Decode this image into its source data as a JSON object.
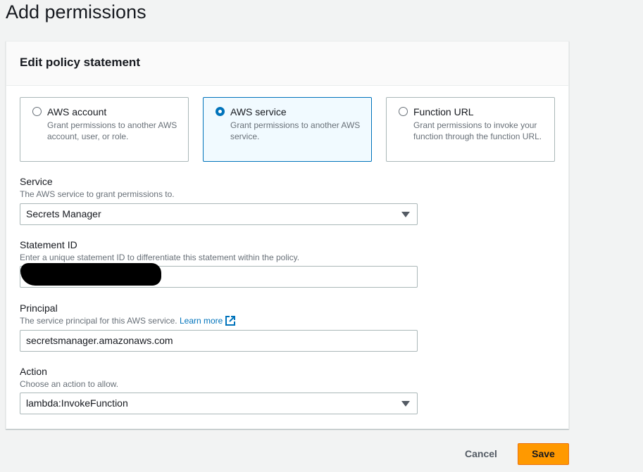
{
  "page": {
    "title": "Add permissions"
  },
  "card": {
    "title": "Edit policy statement"
  },
  "tiles": [
    {
      "title": "AWS account",
      "description": "Grant permissions to another AWS account, user, or role.",
      "selected": false
    },
    {
      "title": "AWS service",
      "description": "Grant permissions to another AWS service.",
      "selected": true
    },
    {
      "title": "Function URL",
      "description": "Grant permissions to invoke your function through the function URL.",
      "selected": false
    }
  ],
  "service": {
    "label": "Service",
    "description": "The AWS service to grant permissions to.",
    "value": "Secrets Manager"
  },
  "statement_id": {
    "label": "Statement ID",
    "description": "Enter a unique statement ID to differentiate this statement within the policy.",
    "value": ""
  },
  "principal": {
    "label": "Principal",
    "description": "The service principal for this AWS service.",
    "learn_more": "Learn more",
    "value": "secretsmanager.amazonaws.com"
  },
  "action": {
    "label": "Action",
    "description": "Choose an action to allow.",
    "value": "lambda:InvokeFunction"
  },
  "footer": {
    "cancel": "Cancel",
    "save": "Save"
  },
  "colors": {
    "accent": "#0073bb",
    "primary_button": "#ff9900"
  }
}
